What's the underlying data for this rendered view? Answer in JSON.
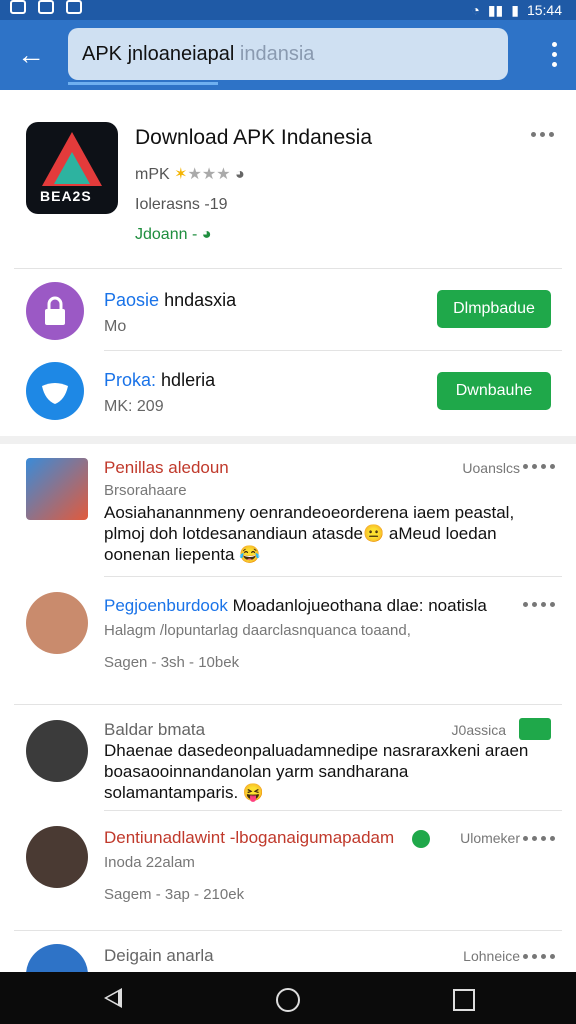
{
  "status": {
    "time": "15:44"
  },
  "search": {
    "query": "APK jnloaneiapal",
    "faint": "indansia"
  },
  "app": {
    "title": "Download APK Indanesia",
    "icon_text": "BEA2S",
    "rating_label": "mPK",
    "rating": 2,
    "rating_max": 5,
    "size": "Iolerasns -19",
    "install": "Jdoann -"
  },
  "related": [
    {
      "title_blue": "Paosie",
      "title_rest": "hndasxia",
      "sub": "Mo",
      "button": "Dlmpbadue",
      "icon_color": "#9b59c5",
      "icon": "lock-icon"
    },
    {
      "title_blue": "Proka:",
      "title_rest": "hdleria",
      "sub": "MK: 209",
      "button": "Dwnbauhe",
      "icon_color": "#1e88e5",
      "icon": "shield-icon"
    }
  ],
  "reviews": [
    {
      "name": "Penillas aledoun",
      "name_color": "#c0392b",
      "tag": "Uoanslcs",
      "meta": "Brsorahaare",
      "body": "Aosiahanannmeny oenrandeoeorderena iaem peastal, plmoj doh lotdesanandiaun atasde😐 aMeud loedan oonenan liepenta 😂"
    },
    {
      "name": "Pegjoenburdook",
      "name_rest": "Moadanlojueothana dlae: noatisla",
      "name_color": "#1a73e8",
      "meta": "Halagm /lopuntarlag daarclasnquanca toaand,",
      "meta2": "Sagen - 3sh - 10bek"
    },
    {
      "name": "Baldar bmata",
      "name_color": "#666666",
      "tag": "J0assica",
      "body": "Dhaenae dasedeonpaluadamnedipe nasraraxkeni araen boasaooinnandanolan yarm sandharana solamantamparis. 😝"
    },
    {
      "name": "Dentiunadlawint -lboganaigumapadam",
      "name_color": "#c0392b",
      "tag": "Ulomeker",
      "meta": "Inoda 22alam",
      "meta2": "Sagem - 3ap - 210ek"
    },
    {
      "name": "Deigain anarla",
      "name_color": "#666666",
      "tag": "Lohneice"
    }
  ]
}
